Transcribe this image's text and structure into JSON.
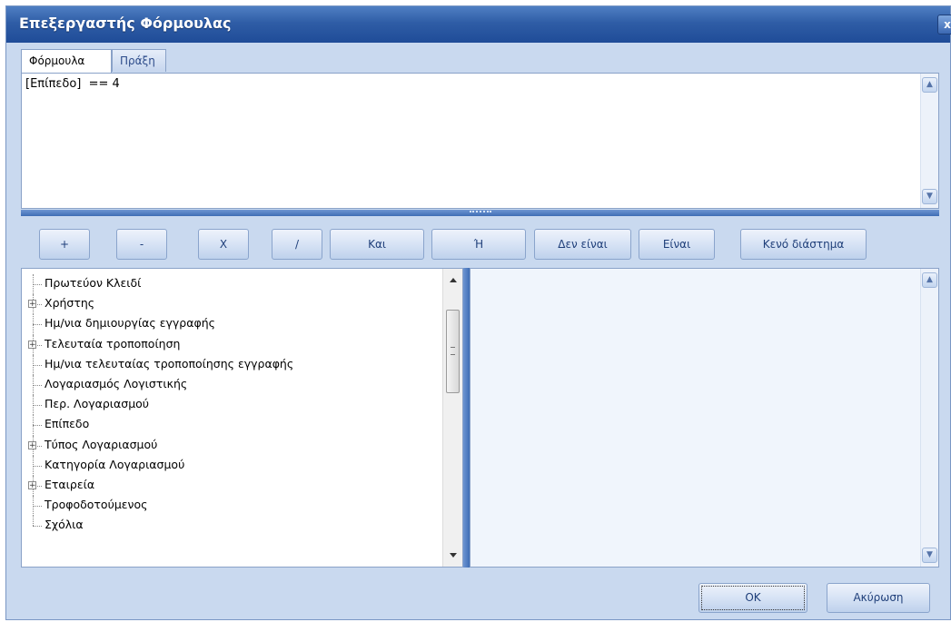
{
  "window": {
    "title": "Επεξεργαστής Φόρμουλας",
    "close_glyph": "x"
  },
  "tabs": [
    {
      "label": "Φόρμουλα",
      "active": true
    },
    {
      "label": "Πράξη",
      "active": false
    }
  ],
  "editor": {
    "value": "[Επίπεδο]  == 4"
  },
  "operators": [
    {
      "label": "+"
    },
    {
      "label": "-"
    },
    {
      "label": "X"
    },
    {
      "label": "/"
    },
    {
      "label": "Και"
    },
    {
      "label": "Ή"
    },
    {
      "label": "Δεν είναι"
    },
    {
      "label": "Είναι"
    },
    {
      "label": "Κενό διάστημα"
    }
  ],
  "fields": [
    {
      "label": "Πρωτεύον Κλειδί",
      "expandable": false
    },
    {
      "label": "Χρήστης",
      "expandable": true
    },
    {
      "label": "Ημ/νια δημιουργίας εγγραφής",
      "expandable": false
    },
    {
      "label": "Τελευταία τροποποίηση",
      "expandable": true
    },
    {
      "label": "Ημ/νια τελευταίας τροποποίησης εγγραφής",
      "expandable": false
    },
    {
      "label": "Λογαριασμός Λογιστικής",
      "expandable": false
    },
    {
      "label": "Περ. Λογαριασμού",
      "expandable": false
    },
    {
      "label": "Επίπεδο",
      "expandable": false
    },
    {
      "label": "Τύπος Λογαριασμού",
      "expandable": true
    },
    {
      "label": "Κατηγορία Λογαριασμού",
      "expandable": false
    },
    {
      "label": "Εταιρεία",
      "expandable": true
    },
    {
      "label": "Τροφοδοτούμενος",
      "expandable": false
    },
    {
      "label": "Σχόλια",
      "expandable": false
    }
  ],
  "footer": {
    "ok_label": "OK",
    "cancel_label": "Ακύρωση"
  },
  "icons": {
    "scroll_up": "scroll-up-icon",
    "scroll_down": "scroll-down-icon",
    "expander": "plus-expander-icon",
    "close": "close-icon"
  },
  "colors": {
    "titlebar": "#2f5da6",
    "window_bg": "#c9d9ef",
    "splitter": "#4f7cc0",
    "button_text": "#1f3f7a"
  }
}
